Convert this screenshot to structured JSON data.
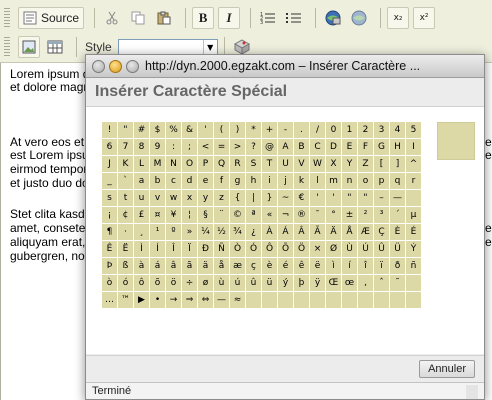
{
  "toolbar": {
    "source_label": "Source",
    "style_label": "Style",
    "style_value": "",
    "bold_label": "B",
    "italic_label": "I",
    "subscript_label": "x₂",
    "superscript_label": "x²"
  },
  "editor": {
    "lines": [
      "Lorem ipsum d",
      "et dolore magn",
      "At vero eos et",
      "est Lorem ipsu",
      "eirmod tempor",
      "et justo duo do",
      "Stet clita kasd",
      "amet, consete",
      "aliquyam erat,",
      "gubergren, no"
    ],
    "right_fragments": [
      "e",
      "e",
      "e",
      "e"
    ]
  },
  "popup": {
    "window_title": "http://dyn.2000.egzakt.com – Insérer Caractère ...",
    "heading": "Insérer Caractère Spécial",
    "cancel_label": "Annuler",
    "status": "Terminé",
    "grid": [
      [
        "!",
        "\"",
        "#",
        "$",
        "%",
        "&",
        "'",
        "(",
        ")",
        "*",
        "+",
        "-",
        ".",
        "/",
        "0",
        "1",
        "2",
        "3",
        "4",
        "5"
      ],
      [
        "6",
        "7",
        "8",
        "9",
        ":",
        ";",
        "<",
        "=",
        ">",
        "?",
        "@",
        "A",
        "B",
        "C",
        "D",
        "E",
        "F",
        "G",
        "H",
        "I"
      ],
      [
        "J",
        "K",
        "L",
        "M",
        "N",
        "O",
        "P",
        "Q",
        "R",
        "S",
        "T",
        "U",
        "V",
        "W",
        "X",
        "Y",
        "Z",
        "[",
        "]",
        "^"
      ],
      [
        "_",
        "`",
        "a",
        "b",
        "c",
        "d",
        "e",
        "f",
        "g",
        "h",
        "i",
        "j",
        "k",
        "l",
        "m",
        "n",
        "o",
        "p",
        "q",
        "r"
      ],
      [
        "s",
        "t",
        "u",
        "v",
        "w",
        "x",
        "y",
        "z",
        "{",
        "|",
        "}",
        "~",
        "€",
        "'",
        "'",
        "\"",
        "\"",
        "–",
        "—",
        ""
      ],
      [
        "¡",
        "¢",
        "£",
        "¤",
        "¥",
        "¦",
        "§",
        "¨",
        "©",
        "ª",
        "«",
        "¬",
        "®",
        "¯",
        "°",
        "±",
        "²",
        "³",
        "´",
        "µ"
      ],
      [
        "¶",
        "·",
        "¸",
        "¹",
        "º",
        "»",
        "¼",
        "½",
        "¾",
        "¿",
        "À",
        "Á",
        "Â",
        "Ã",
        "Ä",
        "Å",
        "Æ",
        "Ç",
        "È",
        "É"
      ],
      [
        "Ê",
        "Ë",
        "Ì",
        "Í",
        "Î",
        "Ï",
        "Ð",
        "Ñ",
        "Ò",
        "Ó",
        "Ô",
        "Õ",
        "Ö",
        "×",
        "Ø",
        "Ù",
        "Ú",
        "Û",
        "Ü",
        "Ý"
      ],
      [
        "Þ",
        "ß",
        "à",
        "á",
        "â",
        "ã",
        "ä",
        "å",
        "æ",
        "ç",
        "è",
        "é",
        "ê",
        "ë",
        "ì",
        "í",
        "î",
        "ï",
        "ð",
        "ñ"
      ],
      [
        "ò",
        "ó",
        "ô",
        "õ",
        "ö",
        "÷",
        "ø",
        "ù",
        "ú",
        "û",
        "ü",
        "ý",
        "þ",
        "ÿ",
        "Œ",
        "œ",
        ",",
        "ˆ",
        "˜",
        ""
      ],
      [
        "…",
        "™",
        "▶",
        "•",
        "→",
        "⇒",
        "⇔",
        "—",
        "≈",
        "",
        "",
        "",
        "",
        "",
        "",
        "",
        "",
        "",
        "",
        ""
      ]
    ]
  },
  "colors": {
    "grid_cell": "#dcd9a6",
    "toolbar_bg": "#efefde"
  },
  "icons": [
    "source-icon",
    "cut-icon",
    "copy-icon",
    "paste-icon",
    "ordered-list-icon",
    "unordered-list-icon",
    "link-icon",
    "unlink-icon",
    "image-icon",
    "table-icon",
    "style-remove-icon"
  ]
}
